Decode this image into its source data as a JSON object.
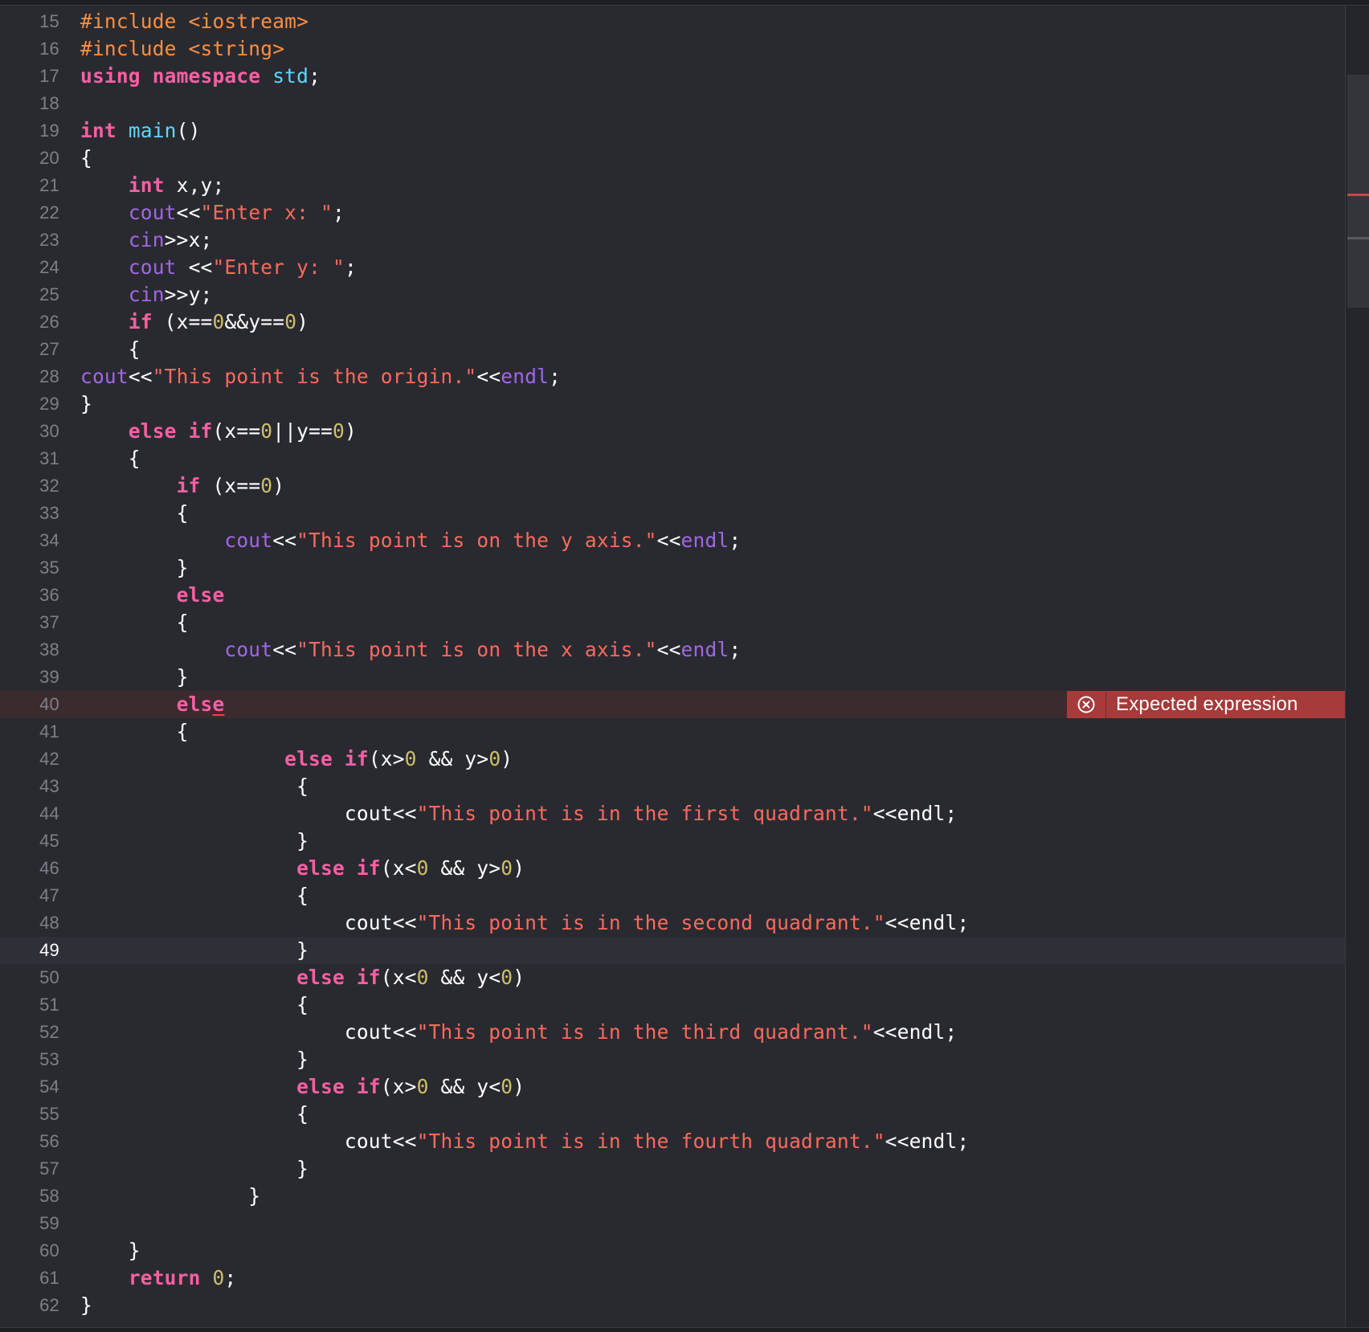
{
  "error": {
    "message": "Expected expression",
    "icon": "error-circle-x-icon",
    "color": "#a73a3a"
  },
  "colors": {
    "background": "#292a30",
    "keyword": "#fc5fa3",
    "preprocessor": "#fd8f3f",
    "string": "#fc6a5d",
    "number": "#d0bf69",
    "function": "#a167e6",
    "type": "#5dd8ff",
    "plain": "#ffffff",
    "line_number": "#7f8087"
  },
  "lines": [
    {
      "n": "15",
      "tokens": [
        [
          "pp",
          "#include <iostream>"
        ]
      ]
    },
    {
      "n": "16",
      "tokens": [
        [
          "pp",
          "#include <string>"
        ]
      ]
    },
    {
      "n": "17",
      "tokens": [
        [
          "kw",
          "using namespace"
        ],
        [
          "id",
          " "
        ],
        [
          "typ",
          "std"
        ],
        [
          "id",
          ";"
        ]
      ]
    },
    {
      "n": "18",
      "tokens": []
    },
    {
      "n": "19",
      "tokens": [
        [
          "kw",
          "int"
        ],
        [
          "id",
          " "
        ],
        [
          "typ",
          "main"
        ],
        [
          "id",
          "()"
        ]
      ]
    },
    {
      "n": "20",
      "tokens": [
        [
          "id",
          "{"
        ]
      ]
    },
    {
      "n": "21",
      "tokens": [
        [
          "id",
          "    "
        ],
        [
          "kw",
          "int"
        ],
        [
          "id",
          " x,y;"
        ]
      ]
    },
    {
      "n": "22",
      "tokens": [
        [
          "id",
          "    "
        ],
        [
          "fn",
          "cout"
        ],
        [
          "id",
          "<<"
        ],
        [
          "str",
          "\"Enter x: \""
        ],
        [
          "id",
          ";"
        ]
      ]
    },
    {
      "n": "23",
      "tokens": [
        [
          "id",
          "    "
        ],
        [
          "fn",
          "cin"
        ],
        [
          "id",
          ">>x;"
        ]
      ]
    },
    {
      "n": "24",
      "tokens": [
        [
          "id",
          "    "
        ],
        [
          "fn",
          "cout"
        ],
        [
          "id",
          " <<"
        ],
        [
          "str",
          "\"Enter y: \""
        ],
        [
          "id",
          ";"
        ]
      ]
    },
    {
      "n": "25",
      "tokens": [
        [
          "id",
          "    "
        ],
        [
          "fn",
          "cin"
        ],
        [
          "id",
          ">>y;"
        ]
      ]
    },
    {
      "n": "26",
      "tokens": [
        [
          "id",
          "    "
        ],
        [
          "kw",
          "if"
        ],
        [
          "id",
          " (x=="
        ],
        [
          "num",
          "0"
        ],
        [
          "id",
          "&&y=="
        ],
        [
          "num",
          "0"
        ],
        [
          "id",
          ")"
        ]
      ]
    },
    {
      "n": "27",
      "tokens": [
        [
          "id",
          "    {"
        ]
      ]
    },
    {
      "n": "28",
      "tokens": [
        [
          "fn",
          "cout"
        ],
        [
          "id",
          "<<"
        ],
        [
          "str",
          "\"This point is the origin.\""
        ],
        [
          "id",
          "<<"
        ],
        [
          "fn",
          "endl"
        ],
        [
          "id",
          ";"
        ]
      ]
    },
    {
      "n": "29",
      "tokens": [
        [
          "id",
          "}"
        ]
      ]
    },
    {
      "n": "30",
      "tokens": [
        [
          "id",
          "    "
        ],
        [
          "kw",
          "else if"
        ],
        [
          "id",
          "(x=="
        ],
        [
          "num",
          "0"
        ],
        [
          "id",
          "||y=="
        ],
        [
          "num",
          "0"
        ],
        [
          "id",
          ")"
        ]
      ]
    },
    {
      "n": "31",
      "tokens": [
        [
          "id",
          "    {"
        ]
      ]
    },
    {
      "n": "32",
      "tokens": [
        [
          "id",
          "        "
        ],
        [
          "kw",
          "if"
        ],
        [
          "id",
          " (x=="
        ],
        [
          "num",
          "0"
        ],
        [
          "id",
          ")"
        ]
      ]
    },
    {
      "n": "33",
      "tokens": [
        [
          "id",
          "        {"
        ]
      ]
    },
    {
      "n": "34",
      "tokens": [
        [
          "id",
          "            "
        ],
        [
          "fn",
          "cout"
        ],
        [
          "id",
          "<<"
        ],
        [
          "str",
          "\"This point is on the y axis.\""
        ],
        [
          "id",
          "<<"
        ],
        [
          "fn",
          "endl"
        ],
        [
          "id",
          ";"
        ]
      ]
    },
    {
      "n": "35",
      "tokens": [
        [
          "id",
          "        }"
        ]
      ]
    },
    {
      "n": "36",
      "tokens": [
        [
          "id",
          "        "
        ],
        [
          "kw",
          "else"
        ]
      ]
    },
    {
      "n": "37",
      "tokens": [
        [
          "id",
          "        {"
        ]
      ]
    },
    {
      "n": "38",
      "tokens": [
        [
          "id",
          "            "
        ],
        [
          "fn",
          "cout"
        ],
        [
          "id",
          "<<"
        ],
        [
          "str",
          "\"This point is on the x axis.\""
        ],
        [
          "id",
          "<<"
        ],
        [
          "fn",
          "endl"
        ],
        [
          "id",
          ";"
        ]
      ]
    },
    {
      "n": "39",
      "tokens": [
        [
          "id",
          "        }"
        ]
      ]
    },
    {
      "n": "40",
      "tokens": [
        [
          "id",
          "        "
        ],
        [
          "kw",
          "els"
        ],
        [
          "kw err",
          "e"
        ]
      ],
      "error": true
    },
    {
      "n": "41",
      "tokens": [
        [
          "id",
          "        {"
        ]
      ]
    },
    {
      "n": "42",
      "tokens": [
        [
          "id",
          "                 "
        ],
        [
          "kw",
          "else if"
        ],
        [
          "id",
          "(x>"
        ],
        [
          "num",
          "0"
        ],
        [
          "id",
          " && y>"
        ],
        [
          "num",
          "0"
        ],
        [
          "id",
          ")"
        ]
      ]
    },
    {
      "n": "43",
      "tokens": [
        [
          "id",
          "                  {"
        ]
      ]
    },
    {
      "n": "44",
      "tokens": [
        [
          "id",
          "                      cout<<"
        ],
        [
          "str",
          "\"This point is in the first quadrant.\""
        ],
        [
          "id",
          "<<endl;"
        ]
      ]
    },
    {
      "n": "45",
      "tokens": [
        [
          "id",
          "                  }"
        ]
      ]
    },
    {
      "n": "46",
      "tokens": [
        [
          "id",
          "                  "
        ],
        [
          "kw",
          "else if"
        ],
        [
          "id",
          "(x<"
        ],
        [
          "num",
          "0"
        ],
        [
          "id",
          " && y>"
        ],
        [
          "num",
          "0"
        ],
        [
          "id",
          ")"
        ]
      ]
    },
    {
      "n": "47",
      "tokens": [
        [
          "id",
          "                  {"
        ]
      ]
    },
    {
      "n": "48",
      "tokens": [
        [
          "id",
          "                      cout<<"
        ],
        [
          "str",
          "\"This point is in the second quadrant.\""
        ],
        [
          "id",
          "<<endl;"
        ]
      ]
    },
    {
      "n": "49",
      "tokens": [
        [
          "id",
          "                  }"
        ]
      ],
      "current": true
    },
    {
      "n": "50",
      "tokens": [
        [
          "id",
          "                  "
        ],
        [
          "kw",
          "else if"
        ],
        [
          "id",
          "(x<"
        ],
        [
          "num",
          "0"
        ],
        [
          "id",
          " && y<"
        ],
        [
          "num",
          "0"
        ],
        [
          "id",
          ")"
        ]
      ]
    },
    {
      "n": "51",
      "tokens": [
        [
          "id",
          "                  {"
        ]
      ]
    },
    {
      "n": "52",
      "tokens": [
        [
          "id",
          "                      cout<<"
        ],
        [
          "str",
          "\"This point is in the third quadrant.\""
        ],
        [
          "id",
          "<<endl;"
        ]
      ]
    },
    {
      "n": "53",
      "tokens": [
        [
          "id",
          "                  }"
        ]
      ]
    },
    {
      "n": "54",
      "tokens": [
        [
          "id",
          "                  "
        ],
        [
          "kw",
          "else if"
        ],
        [
          "id",
          "(x>"
        ],
        [
          "num",
          "0"
        ],
        [
          "id",
          " && y<"
        ],
        [
          "num",
          "0"
        ],
        [
          "id",
          ")"
        ]
      ]
    },
    {
      "n": "55",
      "tokens": [
        [
          "id",
          "                  {"
        ]
      ]
    },
    {
      "n": "56",
      "tokens": [
        [
          "id",
          "                      cout<<"
        ],
        [
          "str",
          "\"This point is in the fourth quadrant.\""
        ],
        [
          "id",
          "<<endl;"
        ]
      ]
    },
    {
      "n": "57",
      "tokens": [
        [
          "id",
          "                  }"
        ]
      ]
    },
    {
      "n": "58",
      "tokens": [
        [
          "id",
          "              }"
        ]
      ]
    },
    {
      "n": "59",
      "tokens": []
    },
    {
      "n": "60",
      "tokens": [
        [
          "id",
          "    }"
        ]
      ]
    },
    {
      "n": "61",
      "tokens": [
        [
          "id",
          "    "
        ],
        [
          "kw",
          "return"
        ],
        [
          "id",
          " "
        ],
        [
          "num",
          "0"
        ],
        [
          "id",
          ";"
        ]
      ]
    },
    {
      "n": "62",
      "tokens": [
        [
          "id",
          "}"
        ]
      ]
    }
  ]
}
